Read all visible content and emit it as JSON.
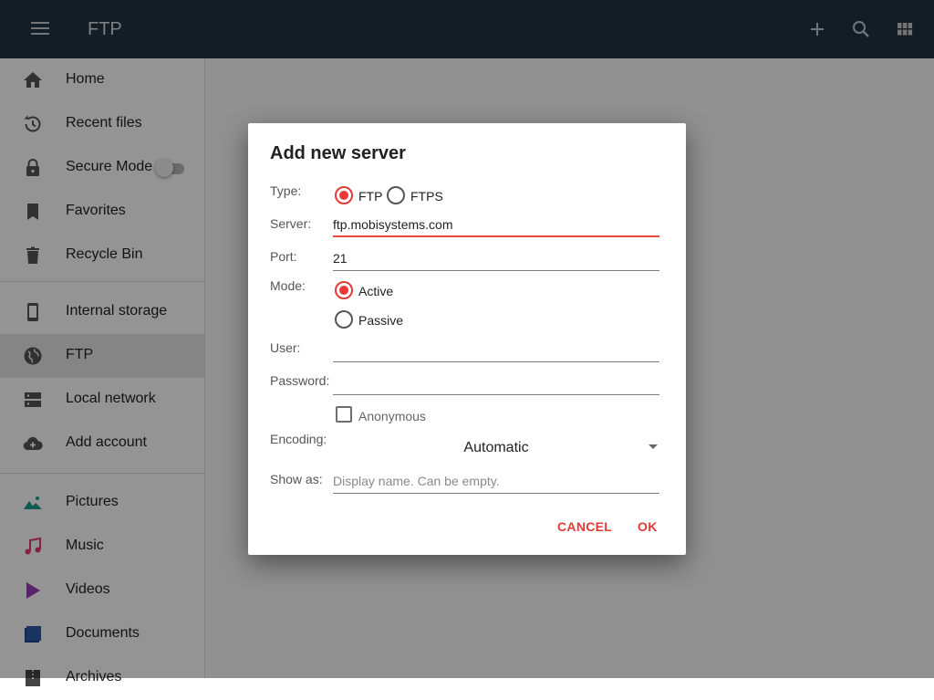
{
  "appbar": {
    "title": "FTP",
    "icons": [
      "menu-icon",
      "add-icon",
      "search-icon",
      "grid-view-icon"
    ],
    "color": "#213242"
  },
  "sidebar": {
    "items": [
      {
        "label": "Home",
        "icon": "home-icon"
      },
      {
        "label": "Recent files",
        "icon": "history-icon"
      },
      {
        "label": "Secure Mode",
        "icon": "lock-icon",
        "toggle": false
      },
      {
        "label": "Favorites",
        "icon": "bookmark-icon"
      },
      {
        "label": "Recycle Bin",
        "icon": "trash-icon"
      },
      {
        "label": "Internal storage",
        "icon": "phone-icon"
      },
      {
        "label": "FTP",
        "icon": "globe-icon",
        "selected": true
      },
      {
        "label": "Local network",
        "icon": "server-icon"
      },
      {
        "label": "Add account",
        "icon": "cloud-add-icon"
      },
      {
        "label": "Pictures",
        "icon": "picture-icon",
        "color": "#1a9e8c"
      },
      {
        "label": "Music",
        "icon": "music-note-icon",
        "color": "#e03e6a"
      },
      {
        "label": "Videos",
        "icon": "play-icon",
        "color": "#9c3fb8"
      },
      {
        "label": "Documents",
        "icon": "document-icon",
        "color": "#2b5aa8"
      },
      {
        "label": "Archives",
        "icon": "archive-icon"
      }
    ]
  },
  "dialog": {
    "title": "Add new server",
    "type_label": "Type:",
    "type_options": [
      "FTP",
      "FTPS"
    ],
    "type_selected": "FTP",
    "server_label": "Server:",
    "server_value": "ftp.mobisystems.com",
    "port_label": "Port:",
    "port_value": "21",
    "mode_label": "Mode:",
    "mode_options": [
      "Active",
      "Passive"
    ],
    "mode_selected": "Active",
    "user_label": "User:",
    "user_value": "",
    "password_label": "Password:",
    "password_value": "",
    "anonymous_label": "Anonymous",
    "anonymous_checked": false,
    "encoding_label": "Encoding:",
    "encoding_value": "Automatic",
    "showas_label": "Show as:",
    "showas_placeholder": "Display name. Can be empty.",
    "cancel_label": "CANCEL",
    "ok_label": "OK",
    "accent_color": "#e53935"
  }
}
